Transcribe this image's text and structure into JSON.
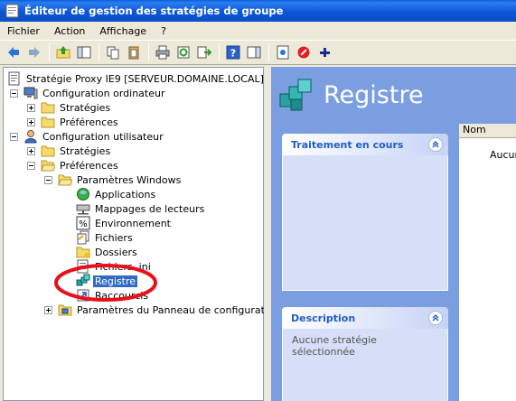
{
  "window": {
    "title": "Éditeur de gestion des stratégies de groupe"
  },
  "menu": [
    "Fichier",
    "Action",
    "Affichage",
    "?"
  ],
  "tree": {
    "root": "Stratégie Proxy IE9  [SERVEUR.DOMAINE.LOCAL]",
    "computer_config": "Configuration ordinateur",
    "computer_policies": "Stratégies",
    "computer_prefs": "Préférences",
    "user_config": "Configuration utilisateur",
    "user_policies": "Stratégies",
    "user_prefs": "Préférences",
    "windows_settings": "Paramètres Windows",
    "applications": "Applications",
    "drive_maps": "Mappages de lecteurs",
    "environment": "Environnement",
    "files": "Fichiers",
    "folders": "Dossiers",
    "ini_files": "Fichiers .ini",
    "registry": "Registre",
    "shortcuts": "Raccourcis",
    "control_panel": "Paramètres du Panneau de configuration"
  },
  "right": {
    "title": "Registre",
    "column_name": "Nom",
    "list_empty": "Aucun",
    "processing_header": "Traitement en cours",
    "description_header": "Description",
    "description_text": "Aucune stratégie sélectionnée"
  },
  "colors": {
    "selection": "#316ac5",
    "annotation_circle": "#e8101a",
    "titlebar": "#0a56d6"
  }
}
